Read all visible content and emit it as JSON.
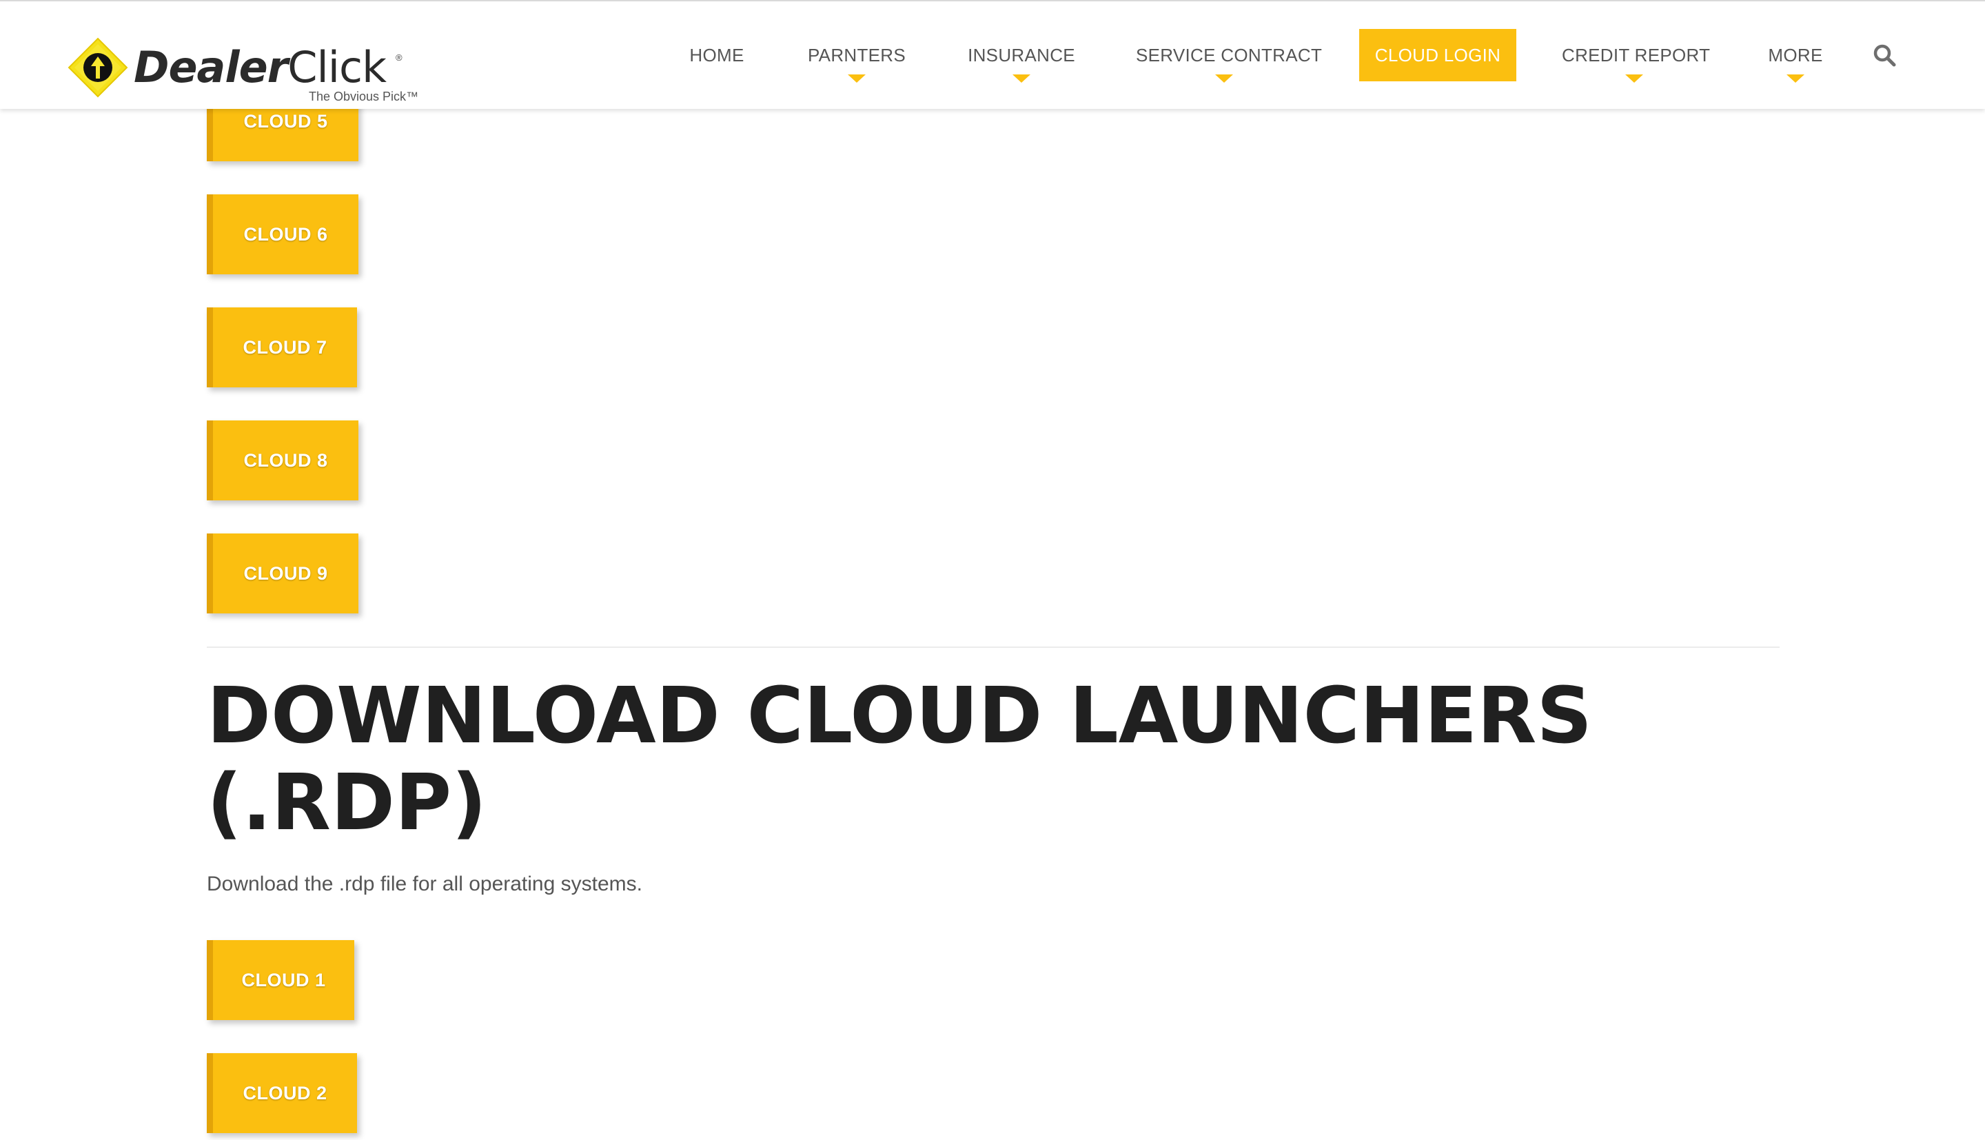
{
  "header": {
    "logo": {
      "brand_bold": "Dealer",
      "brand_light": "Click",
      "registered": "®",
      "tagline": "The Obvious Pick™"
    },
    "nav": [
      {
        "label": "HOME",
        "has_dropdown": false,
        "active": false
      },
      {
        "label": "PARNTERS",
        "has_dropdown": true,
        "active": false
      },
      {
        "label": "INSURANCE",
        "has_dropdown": true,
        "active": false
      },
      {
        "label": "SERVICE CONTRACT",
        "has_dropdown": true,
        "active": false
      },
      {
        "label": "CLOUD LOGIN",
        "has_dropdown": false,
        "active": true
      },
      {
        "label": "CREDIT REPORT",
        "has_dropdown": true,
        "active": false
      },
      {
        "label": "MORE",
        "has_dropdown": true,
        "active": false
      }
    ],
    "search_icon": "search-icon"
  },
  "upper_buttons": [
    {
      "label": "CLOUD 5"
    },
    {
      "label": "CLOUD 6"
    },
    {
      "label": "CLOUD 7"
    },
    {
      "label": "CLOUD 8"
    },
    {
      "label": "CLOUD 9"
    }
  ],
  "launchers": {
    "title": "DOWNLOAD CLOUD LAUNCHERS (.RDP)",
    "description": "Download the .rdp file for all operating systems.",
    "buttons": [
      {
        "label": "CLOUD 1"
      },
      {
        "label": "CLOUD 2"
      }
    ]
  },
  "colors": {
    "accent": "#fbbf10",
    "accent_dark": "#e3a308",
    "heading": "#202020",
    "nav_text": "#555555"
  }
}
